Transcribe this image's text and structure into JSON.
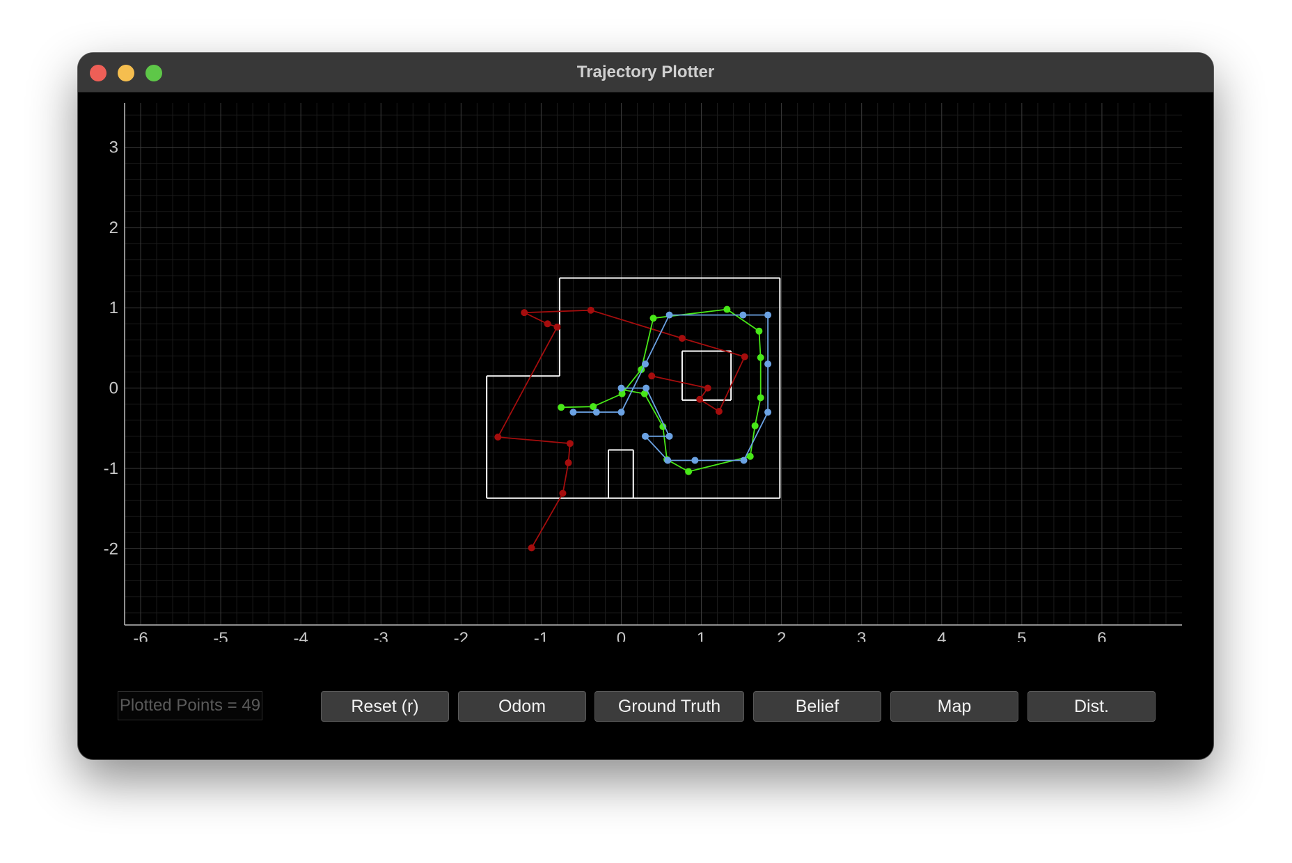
{
  "window": {
    "title": "Trajectory Plotter"
  },
  "controls": {
    "counter_text": "Plotted Points = 49",
    "buttons": [
      "Reset (r)",
      "Odom",
      "Ground Truth",
      "Belief",
      "Map",
      "Dist."
    ]
  },
  "chart_data": {
    "type": "line",
    "title": "",
    "xlabel": "",
    "ylabel": "",
    "xlim": [
      -6.2,
      7.0
    ],
    "ylim": [
      -2.95,
      3.55
    ],
    "xticks": [
      -6,
      -5,
      -4,
      -3,
      -2,
      -1,
      0,
      1,
      2,
      3,
      4,
      5,
      6
    ],
    "yticks": [
      -2,
      -1,
      0,
      1,
      2,
      3
    ],
    "grid": true,
    "background": "#000000",
    "map": {
      "color": "#ffffff",
      "segments": [
        [
          [
            -1.68,
            -1.37
          ],
          [
            1.98,
            -1.37
          ]
        ],
        [
          [
            1.98,
            -1.37
          ],
          [
            1.98,
            1.37
          ]
        ],
        [
          [
            1.98,
            1.37
          ],
          [
            -0.77,
            1.37
          ]
        ],
        [
          [
            -0.77,
            1.37
          ],
          [
            -0.77,
            0.15
          ]
        ],
        [
          [
            -0.77,
            0.15
          ],
          [
            -1.68,
            0.15
          ]
        ],
        [
          [
            -1.68,
            0.15
          ],
          [
            -1.68,
            -1.37
          ]
        ],
        [
          [
            -0.16,
            -1.37
          ],
          [
            -0.16,
            -0.77
          ]
        ],
        [
          [
            -0.16,
            -0.77
          ],
          [
            0.15,
            -0.77
          ]
        ],
        [
          [
            0.15,
            -0.77
          ],
          [
            0.15,
            -1.37
          ]
        ],
        [
          [
            0.76,
            0.46
          ],
          [
            1.37,
            0.46
          ]
        ],
        [
          [
            1.37,
            0.46
          ],
          [
            1.37,
            -0.15
          ]
        ],
        [
          [
            1.37,
            -0.15
          ],
          [
            0.76,
            -0.15
          ]
        ],
        [
          [
            0.76,
            -0.15
          ],
          [
            0.76,
            0.46
          ]
        ]
      ]
    },
    "series": [
      {
        "color": "#a50d0d",
        "points": [
          [
            -1.12,
            -1.99
          ],
          [
            -0.73,
            -1.31
          ],
          [
            -0.66,
            -0.93
          ],
          [
            -0.64,
            -0.69
          ],
          [
            -1.54,
            -0.61
          ],
          [
            -0.8,
            0.76
          ],
          [
            -0.92,
            0.8
          ],
          [
            -1.21,
            0.94
          ],
          [
            -0.38,
            0.97
          ],
          [
            0.76,
            0.62
          ],
          [
            1.54,
            0.39
          ],
          [
            1.22,
            -0.29
          ],
          [
            0.98,
            -0.14
          ],
          [
            1.08,
            0.0
          ],
          [
            0.38,
            0.15
          ]
        ]
      },
      {
        "color": "#48e818",
        "points": [
          [
            -0.75,
            -0.24
          ],
          [
            -0.35,
            -0.23
          ],
          [
            0.01,
            -0.07
          ],
          [
            0.25,
            0.23
          ],
          [
            0.4,
            0.87
          ],
          [
            1.32,
            0.98
          ],
          [
            1.72,
            0.71
          ],
          [
            1.74,
            0.38
          ],
          [
            1.74,
            -0.12
          ],
          [
            1.67,
            -0.47
          ],
          [
            1.61,
            -0.85
          ],
          [
            0.84,
            -1.04
          ],
          [
            0.57,
            -0.89
          ],
          [
            0.52,
            -0.48
          ],
          [
            0.29,
            -0.07
          ],
          [
            0.01,
            -0.02
          ]
        ]
      },
      {
        "color": "#6ba2e3",
        "points": [
          [
            0.0,
            0.0
          ],
          [
            0.31,
            0.0
          ],
          [
            0.6,
            -0.6
          ],
          [
            0.3,
            -0.6
          ],
          [
            0.58,
            -0.9
          ],
          [
            0.92,
            -0.9
          ],
          [
            1.53,
            -0.9
          ],
          [
            1.83,
            -0.3
          ],
          [
            1.83,
            0.3
          ],
          [
            1.83,
            0.91
          ],
          [
            1.52,
            0.91
          ],
          [
            0.6,
            0.91
          ],
          [
            0.3,
            0.3
          ],
          [
            0.0,
            -0.3
          ],
          [
            -0.31,
            -0.3
          ],
          [
            -0.6,
            -0.3
          ]
        ]
      }
    ]
  }
}
